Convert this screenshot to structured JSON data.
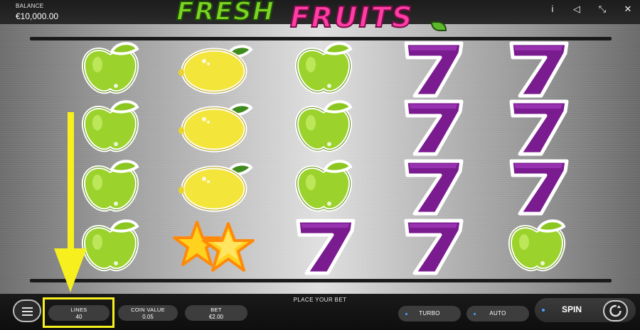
{
  "header": {
    "balance_label": "BALANCE",
    "balance_value": "€10,000.00",
    "logo_word1": "FRESH",
    "logo_word2": "FRUITS",
    "icons": [
      "info-icon",
      "sound-icon",
      "fullscreen-icon",
      "close-icon"
    ],
    "info_glyph": "i",
    "sound_glyph": "◁",
    "fullscreen_glyph": "⤡",
    "close_glyph": "✕"
  },
  "reels": {
    "columns": [
      [
        "apple",
        "apple",
        "apple",
        "apple"
      ],
      [
        "lemon",
        "lemon",
        "lemon",
        "stars"
      ],
      [
        "apple",
        "apple",
        "apple",
        "seven"
      ],
      [
        "seven",
        "seven",
        "seven",
        "seven"
      ],
      [
        "seven",
        "seven",
        "seven",
        "apple"
      ]
    ]
  },
  "controls": {
    "place_bet_text": "PLACE YOUR BET",
    "lines_label": "LINES",
    "lines_value": "40",
    "coin_label": "COIN VALUE",
    "coin_value": "0.05",
    "bet_label": "BET",
    "bet_value": "€2.00",
    "turbo_label": "TURBO",
    "auto_label": "AUTO",
    "spin_label": "SPIN"
  },
  "colors": {
    "annotation": "#f7f01e",
    "apple": "#9bd22b",
    "lemon": "#f3e53a",
    "seven": "#7a1b8f",
    "accent": "#4aa0ff"
  }
}
